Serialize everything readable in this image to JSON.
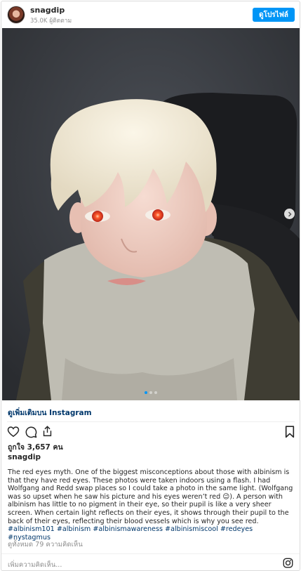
{
  "header": {
    "username": "snagdip",
    "followers": "35.0K ผู้ติดตาม",
    "follow_label": "ดูโปรไฟล์"
  },
  "carousel": {
    "slides": 3,
    "current": 1
  },
  "more_link": "ดูเพิ่มเติมบน Instagram",
  "actions": [
    "heart-icon",
    "comment-icon",
    "share-icon",
    "bookmark-icon"
  ],
  "likes": "ถูกใจ 3,657 คน",
  "caption": {
    "author": "snagdip",
    "text": "The red eyes myth. One of the biggest misconceptions about those with albinism is that they have red eyes. These photos were taken indoors using a flash. I had Wolfgang and Redd swap places so I could take a photo in the same light. (Wolfgang was so upset when he saw his picture and his eyes weren’t red 😉). A person with albinism has little to no pigment in their eye, so their pupil is like a very sheer screen. When certain light reflects on their eyes, it shows through their pupil to the back of their eyes, reflecting their blood vessels which is why you see red.",
    "hashtags": [
      "#albinism101",
      "#albinism",
      "#albinismawareness",
      "#albinismiscool",
      "#redeyes",
      "#nystagmus"
    ]
  },
  "comments_count": "ดูทั้งหมด 79 ความคิดเห็น",
  "add_comment_placeholder": "เพิ่มความคิดเห็น...",
  "colors": {
    "accent": "#0095f6",
    "link": "#00376b",
    "muted": "#8e8e8e"
  }
}
